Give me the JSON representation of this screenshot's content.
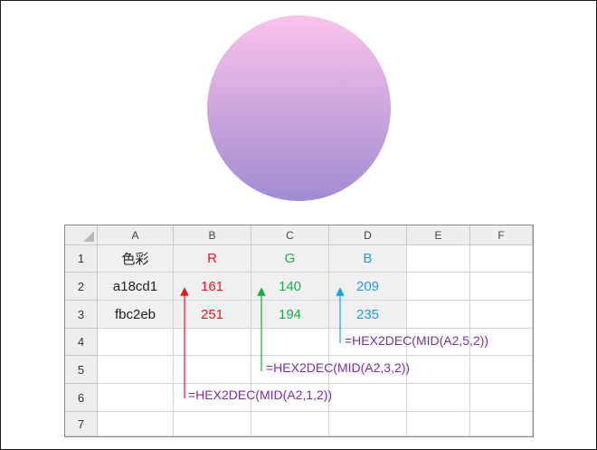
{
  "illustration": {
    "gradient_top": "#fbc2eb",
    "gradient_bottom": "#a18cd1"
  },
  "sheet": {
    "columns": [
      "A",
      "B",
      "C",
      "D",
      "E",
      "F"
    ],
    "rows": [
      "1",
      "2",
      "3",
      "4",
      "5",
      "6",
      "7"
    ],
    "header_row": {
      "label": "色彩",
      "r": "R",
      "g": "G",
      "b": "B"
    },
    "data_rows": [
      {
        "hex": "a18cd1",
        "r": "161",
        "g": "140",
        "b": "209"
      },
      {
        "hex": "fbc2eb",
        "r": "251",
        "g": "194",
        "b": "235"
      }
    ]
  },
  "annotations": {
    "formula_r": "=HEX2DEC(MID(A2,1,2))",
    "formula_g": "=HEX2DEC(MID(A2,3,2))",
    "formula_b": "=HEX2DEC(MID(A2,5,2))"
  },
  "colors": {
    "r": "#e8191d",
    "g": "#1faa4a",
    "b": "#1a9fdc",
    "formula": "#7a2fa0"
  }
}
